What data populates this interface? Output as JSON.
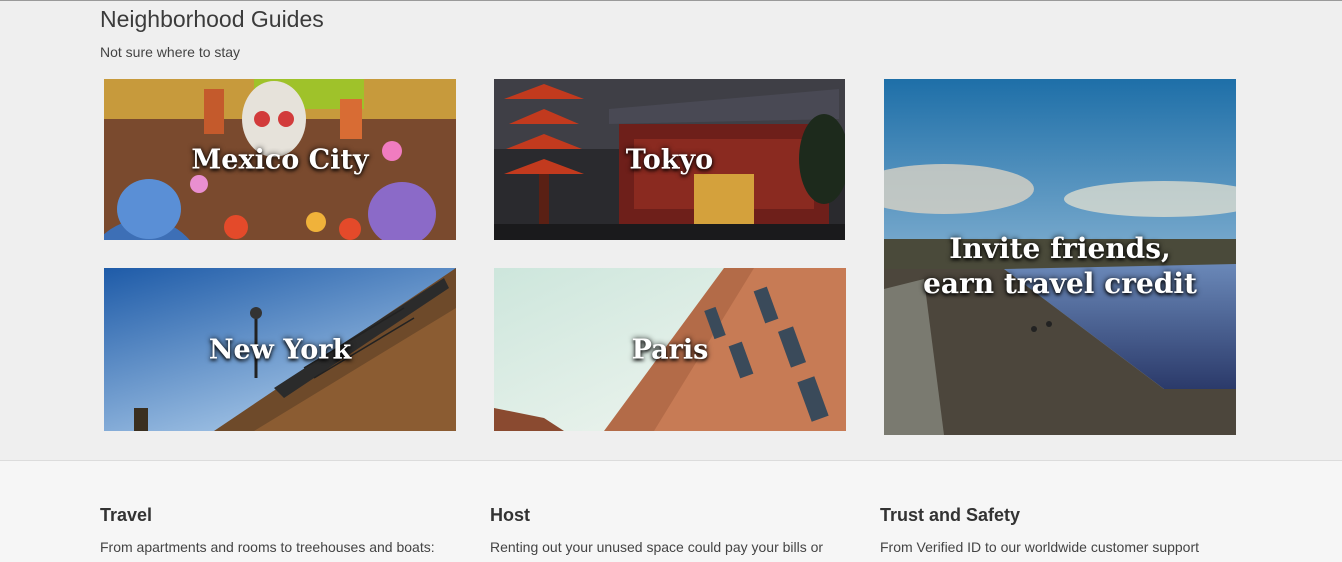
{
  "guides": {
    "title": "Neighborhood Guides",
    "subtitle": "Not sure where to stay",
    "tiles": [
      {
        "label": "Mexico City"
      },
      {
        "label": "Tokyo"
      },
      {
        "label": "New York"
      },
      {
        "label": "Paris"
      }
    ],
    "invite": {
      "line1": "Invite friends,",
      "line2": "earn travel credit"
    }
  },
  "footer": {
    "columns": [
      {
        "heading": "Travel",
        "text": "From apartments and rooms to treehouses and boats:"
      },
      {
        "heading": "Host",
        "text": "Renting out your unused space could pay your bills or"
      },
      {
        "heading": "Trust and Safety",
        "text": "From Verified ID to our worldwide customer support"
      }
    ]
  },
  "colors": {
    "background": "#efefef",
    "footer_background": "#f6f6f6",
    "heading_text": "#333333",
    "tile_label": "#ffffff"
  }
}
